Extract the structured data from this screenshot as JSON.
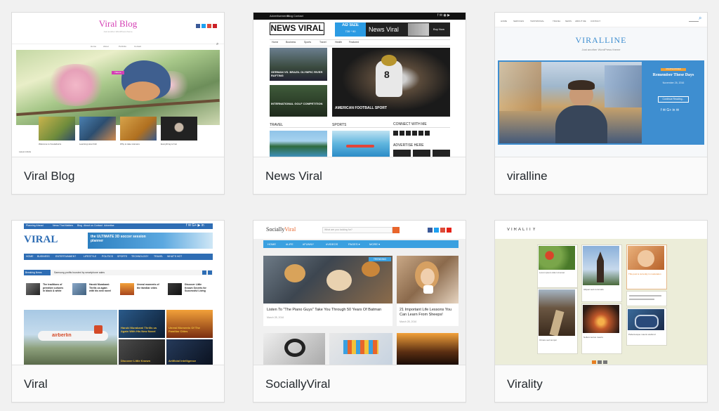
{
  "themes": [
    {
      "name": "Viral Blog",
      "preview": {
        "site_title": "Viral Blog",
        "tagline": "Just another WordPress theme",
        "menu": [
          "Home",
          "About",
          "Portfolio",
          "Contact"
        ],
        "hero_badge": "Nature",
        "thumb_captions": [
          "Welcome to Kookaburra",
          "Learning How Fish",
          "Why to take Humans",
          "Everything is Fun"
        ],
        "footer_label": "Latest Article",
        "accent": "#d43fb4"
      }
    },
    {
      "name": "News Viral",
      "preview": {
        "topbar": [
          "Advertisements",
          "Blog",
          "Contact"
        ],
        "logo": "NEWS VIRAL",
        "ad_size": "AD SIZE",
        "ad_dims": "728 * 90",
        "ad_brand": "News Viral",
        "ad_button": "Buy Now",
        "nav": [
          "Home",
          "Business",
          "Sports",
          "Travel",
          "Health",
          "Featured"
        ],
        "stories": [
          "GERMAN VS. BRAZIL OLYMPIC RIVER RAFTING",
          "INTERNATIONAL GOLF COMPETITION",
          "AMERICAN FOOTBALL SPORT"
        ],
        "sections": [
          "TRAVEL",
          "SPORTS",
          "CONNECT WITH ME",
          "ADVERTISE HERE"
        ],
        "accent": "#2b9be3"
      }
    },
    {
      "name": "viralline",
      "preview": {
        "menu": [
          "HOME",
          "SERVICES",
          "TESTIMONIAL",
          "TRAVEL",
          "NEWS",
          "ABOUT ME",
          "CONTACT"
        ],
        "site_title": "VIRALLINE",
        "tagline": "Just another WordPress theme",
        "post_category": "UNCATEGORIZED",
        "post_title": "Remember These Days",
        "post_date": "November 26, 2016",
        "post_button": "Continue Reading...",
        "accent": "#3e8ed0"
      }
    },
    {
      "name": "Viral",
      "preview": {
        "topbar_items": [
          "Planning Ahead",
          "News That Matters",
          "Blog",
          "About us",
          "Contact",
          "Advertise"
        ],
        "logo": "VIRAL",
        "banner_text": "the ULTIMATE 3D soccer session planner",
        "nav": [
          "HOME",
          "BUSINESS",
          "ENTERTAINMENT",
          "LIFESTYLE",
          "POLITICS",
          "SPORTS",
          "TECHNOLOGY",
          "TRAVEL",
          "WHAT'S HOT"
        ],
        "breaking_label": "Breaking News",
        "breaking_text": "Samsung profits boosted by smartphone sales",
        "news_items": [
          "The traditions of primitive cultures in black & white",
          "Haruki Murakami: Thrills us again with his new novel",
          "Unreal moments of the familiar cities",
          "Discover Little Known Secrets for Successful Living"
        ],
        "grid_titles": [
          "Haruki Murakami Thrills us Again With His New Novel",
          "Unreal Moments Of The Familiar Cities",
          "Discover Little Known",
          "Artificial Intelligence"
        ],
        "accent": "#2e6db4"
      }
    },
    {
      "name": "SociallyViral",
      "preview": {
        "logo_prefix": "Socially",
        "logo_suffix": "Viral",
        "search_placeholder": "What are you looking for?",
        "nav": [
          "HOME",
          "#LIFE",
          "#FUNNY",
          "#VIDEOS",
          "PAGES ▾",
          "MORE ▾"
        ],
        "badge": "TRENDING",
        "post1_title": "Listen To \"The Piano Guys\" Take You Through 50 Years Of Batman",
        "post1_meta": "March 28, 2016",
        "post2_title": "21 Important Life Lessons You Can Learn From Sheeps!",
        "post2_meta": "March 28, 2016",
        "accent": "#e8652b"
      }
    },
    {
      "name": "Virality",
      "preview": {
        "logo": "VIRALITY",
        "card_texts": [
          "Lorem ipsum dolor sit amet",
          "This post is currently in moderation",
          "Aliquet sed commodo",
          "Ornare sed tempor",
          "Nullam lectus mauris",
          "Pellentesque mauris eleifend"
        ],
        "accent": "#e67e22"
      }
    }
  ]
}
